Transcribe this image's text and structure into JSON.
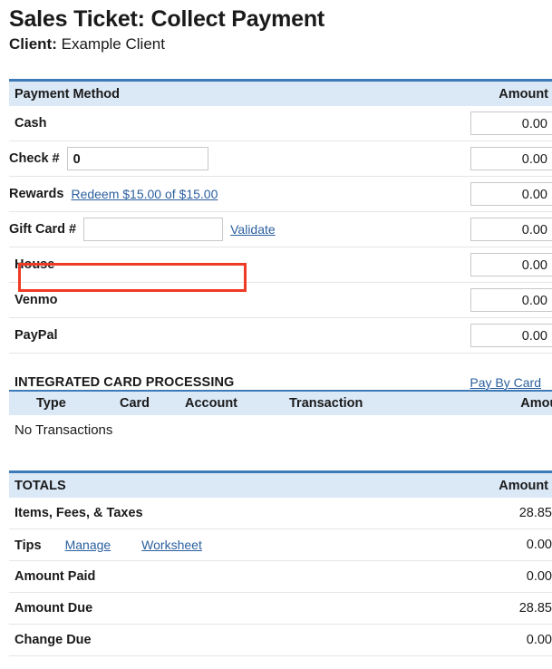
{
  "header": {
    "title": "Sales Ticket: Collect Payment",
    "client_label": "Client:",
    "client_name": "Example Client"
  },
  "payment_table": {
    "col_method": "Payment Method",
    "col_amount": "Amount",
    "rows": [
      {
        "label": "Cash",
        "amount": "0.00"
      },
      {
        "label": "Check #",
        "amount": "0.00",
        "input_value": "0"
      },
      {
        "label": "Rewards",
        "amount": "0.00",
        "link": "Redeem $15.00 of $15.00",
        "highlighted": true
      },
      {
        "label": "Gift Card #",
        "amount": "0.00",
        "input_value": "",
        "link": "Validate"
      },
      {
        "label": "House",
        "amount": "0.00"
      },
      {
        "label": "Venmo",
        "amount": "0.00"
      },
      {
        "label": "PayPal",
        "amount": "0.00"
      }
    ]
  },
  "integrated_card_processing": {
    "title": "INTEGRATED CARD PROCESSING",
    "pay_by_card_link": "Pay By Card",
    "columns": [
      "Type",
      "Card",
      "Account",
      "Transaction",
      "Amount"
    ],
    "empty_message": "No Transactions"
  },
  "totals": {
    "col_title": "TOTALS",
    "col_amount": "Amount",
    "rows": [
      {
        "label": "Items, Fees, & Taxes",
        "value": "28.85"
      },
      {
        "label": "Tips",
        "value": "0.00",
        "links": [
          "Manage",
          "Worksheet"
        ]
      },
      {
        "label": "Amount Paid",
        "value": "0.00"
      },
      {
        "label": "Amount Due",
        "value": "28.85"
      },
      {
        "label": "Change Due",
        "value": "0.00"
      }
    ]
  },
  "colors": {
    "header_band": "#dbe8f6",
    "header_rule": "#3d7ab8",
    "link": "#2b5f9e",
    "highlight_box": "#ef3b25"
  }
}
